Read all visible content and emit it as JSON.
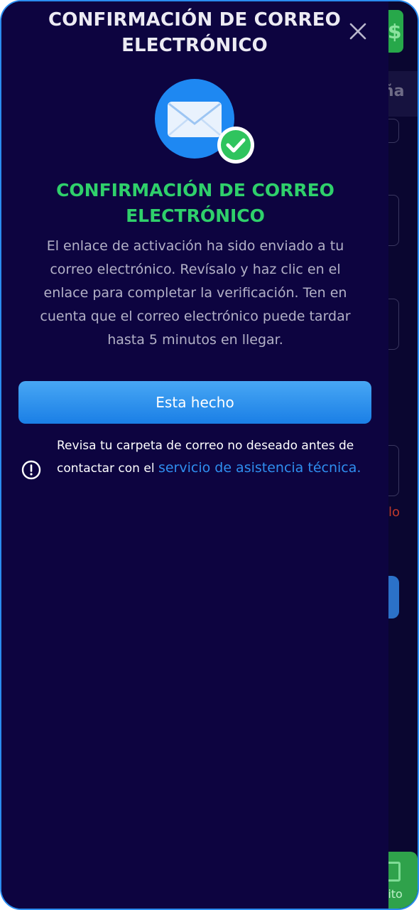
{
  "modal": {
    "title": "CONFIRMACIÓN DE CORREO ELECTRÓNICO",
    "close_icon": "close-icon",
    "illustration_icons": [
      "envelope-icon",
      "check-circle-icon"
    ],
    "success_title": "CONFIRMACIÓN DE CORREO ELECTRÓNICO",
    "message": "El enlace de activación ha sido enviado a tu correo electrónico. Revísalo y haz clic en el enlace para completar la verificación. Ten en cuenta que el correo electrónico puede tardar hasta 5 minutos en llegar.",
    "done_button": "Esta hecho",
    "note": {
      "icon": "info-circle-icon",
      "text": "Revisa tu carpeta de correo no deseado antes de contactar con el ",
      "link": "servicio de asistencia técnica."
    }
  },
  "background_page": {
    "header_fragment": "eña",
    "error_fragment": "lo",
    "bottom_button_fragment": "sito",
    "top_button_symbol": "$"
  },
  "colors": {
    "panel_bg": "#0d0440",
    "accent_blue": "#1a7fe6",
    "success_green": "#2fd06b",
    "link_blue": "#2f8ff0",
    "frame_border": "#2a8cf0"
  }
}
